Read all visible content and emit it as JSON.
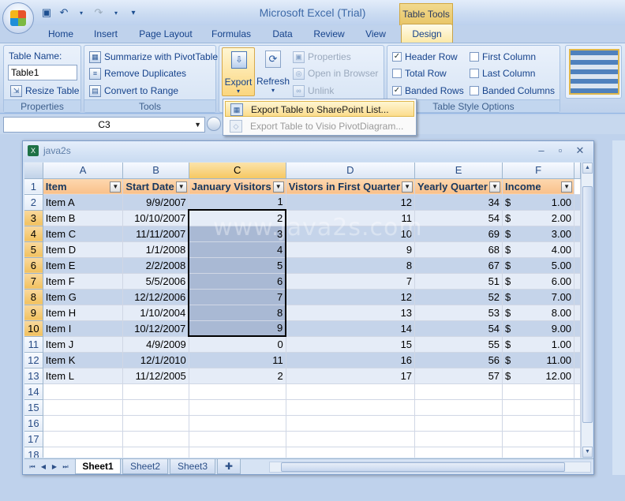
{
  "app_title": "Microsoft Excel (Trial)",
  "contextual_tab": "Table Tools",
  "tabs": [
    "Home",
    "Insert",
    "Page Layout",
    "Formulas",
    "Data",
    "Review",
    "View",
    "Design"
  ],
  "active_tab": "Design",
  "ribbon": {
    "properties": {
      "label": "Properties",
      "table_name_label": "Table Name:",
      "table_name": "Table1",
      "resize": "Resize Table"
    },
    "tools": {
      "label": "Tools",
      "summarize": "Summarize with PivotTable",
      "remove_dup": "Remove Duplicates",
      "convert": "Convert to Range"
    },
    "external": {
      "export": "Export",
      "refresh": "Refresh",
      "properties": "Properties",
      "open_browser": "Open in Browser",
      "unlink": "Unlink"
    },
    "style_options": {
      "label": "Table Style Options",
      "header_row": "Header Row",
      "total_row": "Total Row",
      "banded_rows": "Banded Rows",
      "first_column": "First Column",
      "last_column": "Last Column",
      "banded_columns": "Banded Columns"
    }
  },
  "export_menu": {
    "item1": "Export Table to SharePoint List...",
    "item2": "Export Table to Visio PivotDiagram..."
  },
  "name_box": "C3",
  "workbook": {
    "title": "java2s"
  },
  "columns": [
    "A",
    "B",
    "C",
    "D",
    "E",
    "F"
  ],
  "headers": [
    "Item",
    "Start Date",
    "January Visitors",
    "Vistors in First Quarter",
    "Yearly Quarter",
    "Income"
  ],
  "rows": [
    [
      "Item A",
      "9/9/2007",
      "1",
      "12",
      "34",
      "1.00"
    ],
    [
      "Item B",
      "10/10/2007",
      "2",
      "11",
      "54",
      "2.00"
    ],
    [
      "Item C",
      "11/11/2007",
      "3",
      "10",
      "69",
      "3.00"
    ],
    [
      "Item D",
      "1/1/2008",
      "4",
      "9",
      "68",
      "4.00"
    ],
    [
      "Item E",
      "2/2/2008",
      "5",
      "8",
      "67",
      "5.00"
    ],
    [
      "Item F",
      "5/5/2006",
      "6",
      "7",
      "51",
      "6.00"
    ],
    [
      "Item G",
      "12/12/2006",
      "7",
      "12",
      "52",
      "7.00"
    ],
    [
      "Item H",
      "1/10/2004",
      "8",
      "13",
      "53",
      "8.00"
    ],
    [
      "Item I",
      "10/12/2007",
      "9",
      "14",
      "54",
      "9.00"
    ],
    [
      "Item J",
      "4/9/2009",
      "0",
      "15",
      "55",
      "1.00"
    ],
    [
      "Item K",
      "12/1/2010",
      "11",
      "16",
      "56",
      "11.00"
    ],
    [
      "Item L",
      "11/12/2005",
      "2",
      "17",
      "57",
      "12.00"
    ]
  ],
  "currency_symbol": "$",
  "row_numbers": [
    "1",
    "2",
    "3",
    "4",
    "5",
    "6",
    "7",
    "8",
    "9",
    "10",
    "11",
    "12",
    "13",
    "14",
    "15",
    "16",
    "17",
    "18"
  ],
  "sheets": [
    "Sheet1",
    "Sheet2",
    "Sheet3"
  ],
  "watermark": "www.java2s.com"
}
